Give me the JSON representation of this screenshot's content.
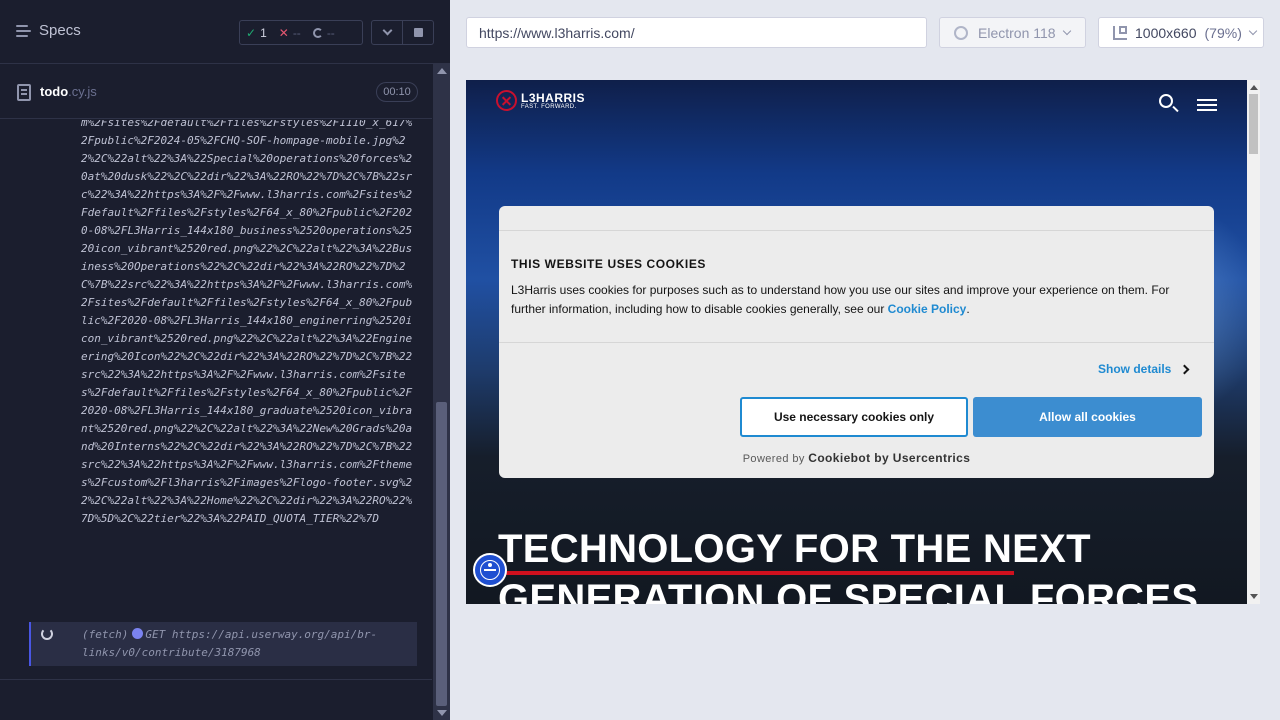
{
  "reporter": {
    "specs_label": "Specs",
    "stats": {
      "passed": "1",
      "failed": "--",
      "pending": "--"
    },
    "spec": {
      "name": "todo",
      "ext": ".cy.js",
      "duration": "00:10"
    },
    "log_text": "m%2Fsites%2Fdefault%2Ffiles%2Fstyles%2F1110_x_617%2Fpublic%2F2024-05%2FCHQ-SOF-hompage-mobile.jpg%22%2C%22alt%22%3A%22Special%20operations%20forces%20at%20dusk%22%2C%22dir%22%3A%22RO%22%7D%2C%7B%22src%22%3A%22https%3A%2F%2Fwww.l3harris.com%2Fsites%2Fdefault%2Ffiles%2Fstyles%2F64_x_80%2Fpublic%2F2020-08%2FL3Harris_144x180_business%2520operations%2520icon_vibrant%2520red.png%22%2C%22alt%22%3A%22Business%20Operations%22%2C%22dir%22%3A%22RO%22%7D%2C%7B%22src%22%3A%22https%3A%2F%2Fwww.l3harris.com%2Fsites%2Fdefault%2Ffiles%2Fstyles%2F64_x_80%2Fpublic%2F2020-08%2FL3Harris_144x180_enginerring%2520icon_vibrant%2520red.png%22%2C%22alt%22%3A%22Engineering%20Icon%22%2C%22dir%22%3A%22RO%22%7D%2C%7B%22src%22%3A%22https%3A%2F%2Fwww.l3harris.com%2Fsites%2Fdefault%2Ffiles%2Fstyles%2F64_x_80%2Fpublic%2F2020-08%2FL3Harris_144x180_graduate%2520icon_vibrant%2520red.png%22%2C%22alt%22%3A%22New%20Grads%20and%20Interns%22%2C%22dir%22%3A%22RO%22%7D%2C%7B%22src%22%3A%22https%3A%2F%2Fwww.l3harris.com%2Fthemes%2Fcustom%2Fl3harris%2Fimages%2Flogo-footer.svg%22%2C%22alt%22%3A%22Home%22%2C%22dir%22%3A%22RO%22%7D%5D%2C%22tier%22%3A%22PAID_QUOTA_TIER%22%7D",
    "fetch": {
      "label": "(fetch)",
      "method": "GET",
      "url": "https://api.userway.org/api/br-links/v0/contribute/3187968"
    }
  },
  "toolbar": {
    "url": "https://www.l3harris.com/",
    "browser": "Electron 118",
    "viewport": "1000x660",
    "zoom": "(79%)"
  },
  "site": {
    "logo_name": "L3HARRIS",
    "logo_tagline": "FAST. FORWARD.",
    "headline_line1": "TECHNOLOGY FOR THE NEXT",
    "headline_line2": "GENERATION OF SPECIAL FORCES"
  },
  "cookie": {
    "title": "THIS WEBSITE USES COOKIES",
    "body": "L3Harris uses cookies for purposes such as to understand how you use our sites and improve your experience on them. For further information, including how to disable cookies generally, see our ",
    "link": "Cookie Policy",
    "body_end": ".",
    "show_details": "Show details",
    "btn_necessary": "Use necessary cookies only",
    "btn_all": "Allow all cookies",
    "powered_prefix": "Powered by",
    "powered_brand": "Cookiebot by Usercentrics"
  },
  "colors": {
    "accent": "#1f8ad1",
    "brand_red": "#d0101e",
    "pass": "#1fa971",
    "fail": "#e45770"
  }
}
